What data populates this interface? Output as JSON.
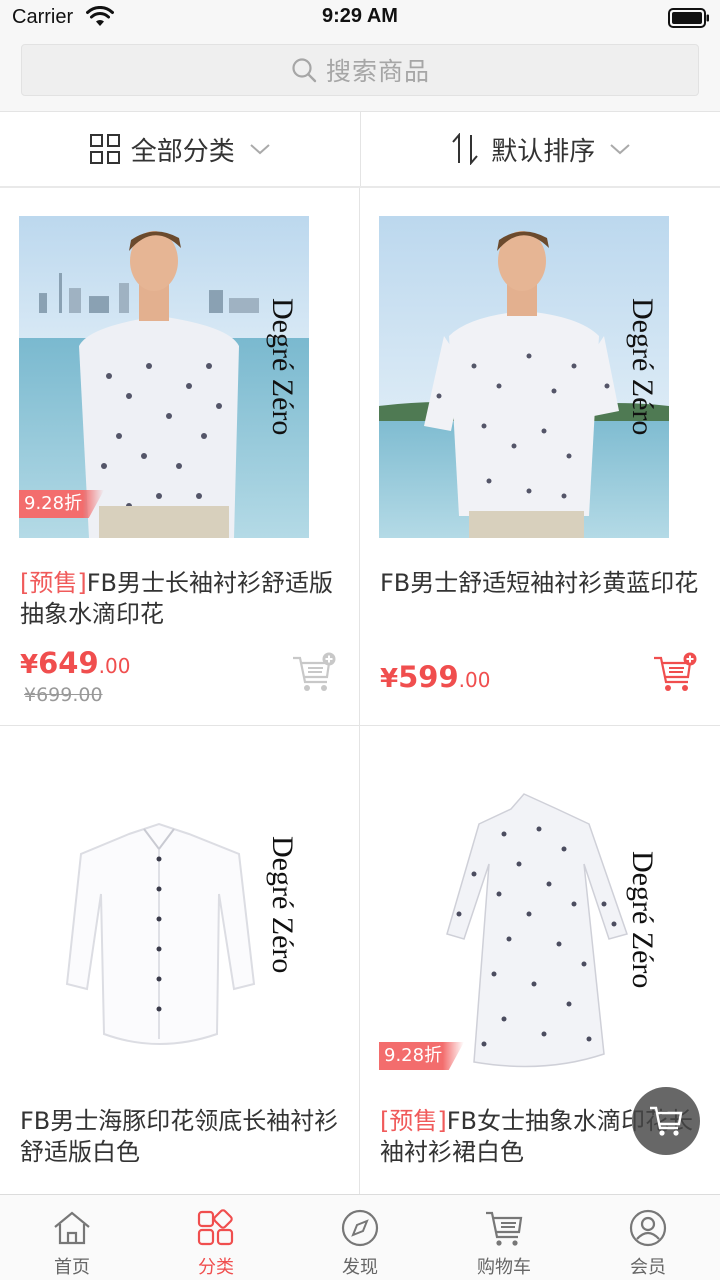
{
  "status_bar": {
    "carrier": "Carrier",
    "time": "9:29 AM"
  },
  "search": {
    "placeholder": "搜索商品",
    "icon": "search-icon"
  },
  "filters": [
    {
      "label": "全部分类",
      "icon": "grid-icon"
    },
    {
      "label": "默认排序",
      "icon": "sort-icon"
    }
  ],
  "products": [
    {
      "presale_tag": "[预售]",
      "title": "FB男士长袖衬衫舒适版抽象水滴印花",
      "price_int": "649",
      "price_dec": ".00",
      "currency": "¥",
      "original_price": "¥699.00",
      "discount": "9.28折",
      "brand": "Degré Zéro"
    },
    {
      "presale_tag": "",
      "title": "FB男士舒适短袖衬衫黄蓝印花",
      "price_int": "599",
      "price_dec": ".00",
      "currency": "¥",
      "original_price": "",
      "discount": "",
      "brand": "Degré Zéro"
    },
    {
      "presale_tag": "",
      "title": "FB男士海豚印花领底长袖衬衫舒适版白色",
      "price_int": "",
      "price_dec": "",
      "currency": "",
      "original_price": "",
      "discount": "",
      "brand": "Degré Zéro"
    },
    {
      "presale_tag": "[预售]",
      "title": "FB女士抽象水滴印花长袖衬衫裙白色",
      "price_int": "",
      "price_dec": "",
      "currency": "",
      "original_price": "",
      "discount": "9.28折",
      "brand": "Degré Zéro"
    }
  ],
  "tab_bar": [
    {
      "label": "首页",
      "icon": "home-icon",
      "active": false
    },
    {
      "label": "分类",
      "icon": "category-icon",
      "active": true
    },
    {
      "label": "发现",
      "icon": "compass-icon",
      "active": false
    },
    {
      "label": "购物车",
      "icon": "cart-icon",
      "active": false
    },
    {
      "label": "会员",
      "icon": "user-icon",
      "active": false
    }
  ],
  "colors": {
    "accent": "#f04e4e",
    "discount_tag": "#f36d6d",
    "text": "#333333",
    "muted": "#999999"
  }
}
